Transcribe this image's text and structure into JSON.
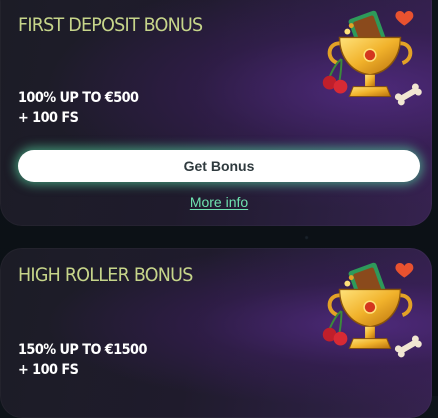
{
  "bonuses": [
    {
      "title": "FIRST DEPOSIT BONUS",
      "offer_line1": "100% UP TO €500",
      "offer_line2": "+ 100 FS",
      "button_label": "Get Bonus",
      "more_info_label": "More info",
      "icon": "golden-trophy-icon"
    },
    {
      "title": "HIGH ROLLER BONUS",
      "offer_line1": "150% UP TO €1500",
      "offer_line2": "+ 100 FS",
      "icon": "golden-trophy-icon"
    }
  ],
  "colors": {
    "title": "#c6d58a",
    "accent_glow": "#5ae6aa",
    "link": "#6fe3b0",
    "card_purple": "#36224f"
  }
}
